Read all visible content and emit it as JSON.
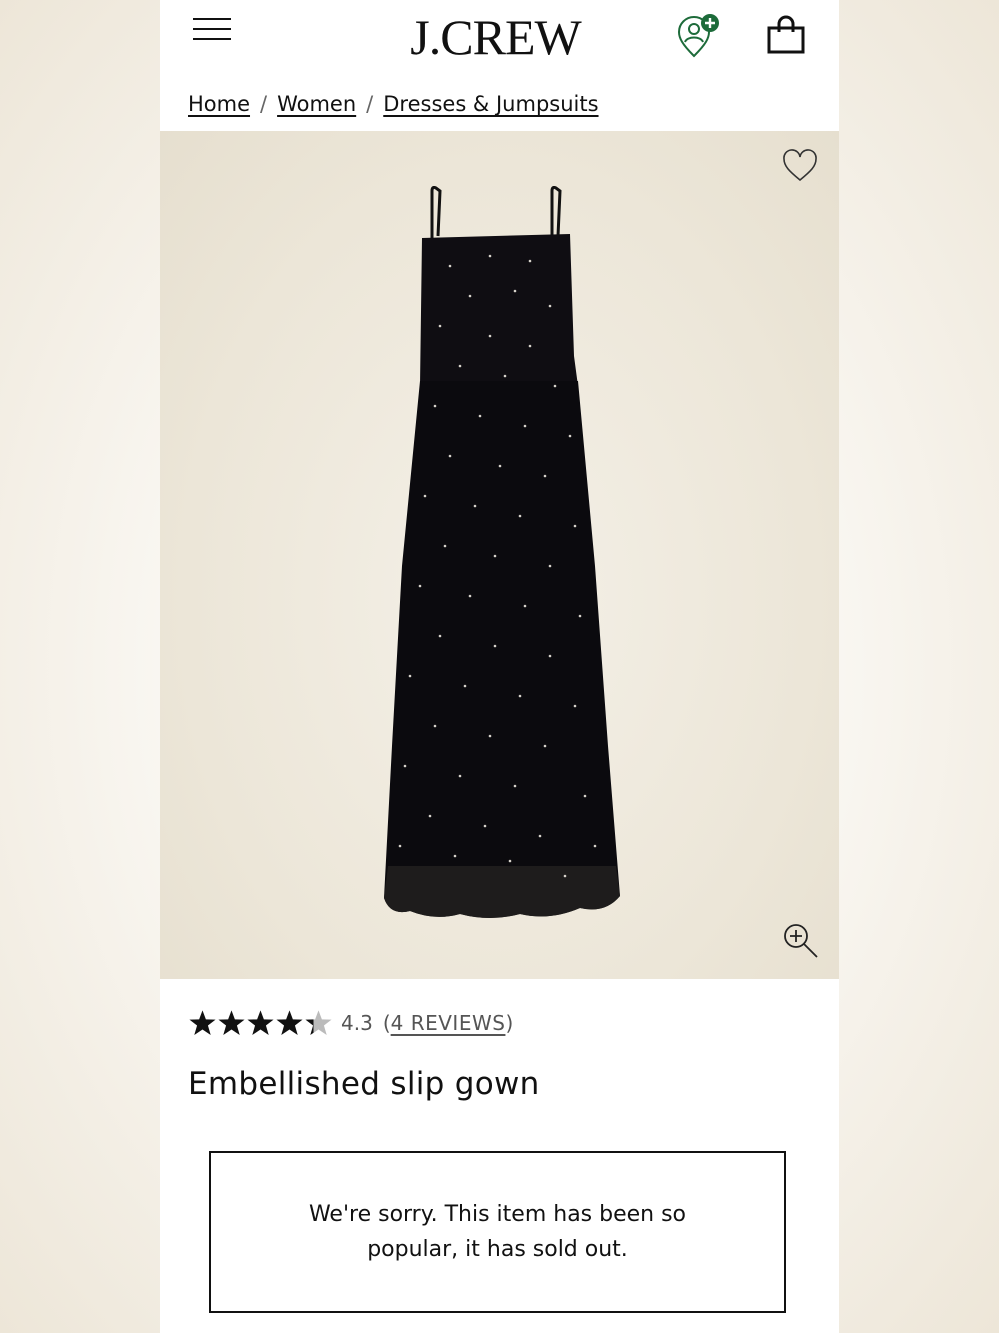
{
  "header": {
    "logo": "J.CREW",
    "menu_icon": "hamburger-menu-icon",
    "location_icon": "store-locator-icon",
    "bag_icon": "shopping-bag-icon",
    "accent_color": "#1d6b3a"
  },
  "breadcrumb": {
    "items": [
      "Home",
      "Women",
      "Dresses & Jumpsuits"
    ],
    "separator": "/"
  },
  "product": {
    "image_bg": "#ece6d8",
    "image_subject": "black embellished slip gown",
    "favorite_icon": "heart-icon",
    "zoom_icon": "zoom-in-icon",
    "rating": {
      "value": "4.3",
      "stars_out_of": 5,
      "stars_filled": 4.3,
      "reviews_open": "(",
      "reviews_label": "4 REVIEWS",
      "reviews_close": ")"
    },
    "title": "Embellished slip gown",
    "sold_out_message": "We're sorry. This item has been so popular, it has sold out."
  }
}
